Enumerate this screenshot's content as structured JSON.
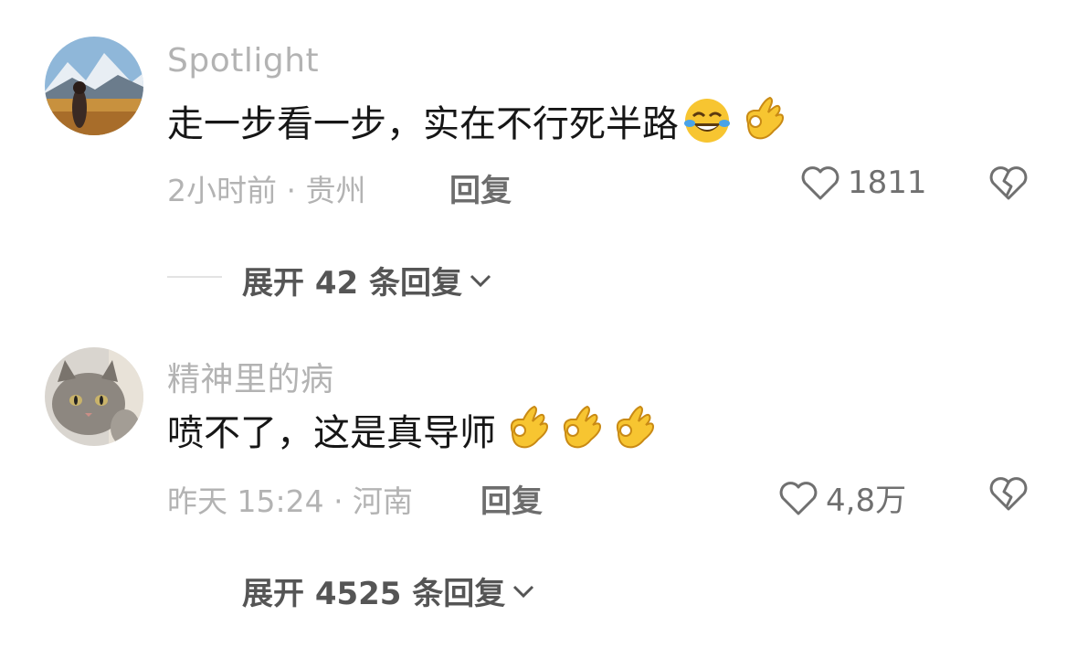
{
  "comments": [
    {
      "username": "Spotlight",
      "content": "走一步看一步，实在不行死半路",
      "emojis": [
        "laughing-crying-emoji",
        "ok-hand-emoji"
      ],
      "meta": "2小时前 · 贵州",
      "reply_label": "回复",
      "likes": "1811",
      "expand_label": "展开 42 条回复"
    },
    {
      "username": "精神里的病",
      "content": "喷不了，这是真导师",
      "emojis": [
        "ok-hand-emoji",
        "ok-hand-emoji",
        "ok-hand-emoji"
      ],
      "meta": "昨天 15:24 · 河南",
      "reply_label": "回复",
      "likes": "4,8万",
      "expand_label": "展开 4525 条回复"
    }
  ],
  "colors": {
    "username": "#b3b3b3",
    "content": "#161616",
    "meta": "#b3b3b3",
    "icon": "#707070",
    "emoji_yellow": "#f7c531"
  }
}
